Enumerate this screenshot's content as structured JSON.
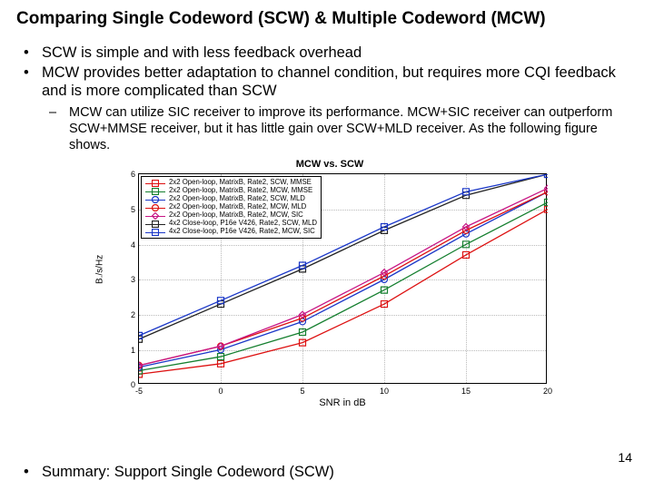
{
  "title": "Comparing Single Codeword (SCW) & Multiple Codeword (MCW)",
  "bullets": {
    "b1": "SCW is simple and with less feedback overhead",
    "b2": "MCW provides better adaptation to channel condition, but requires more CQI feedback and is more complicated than SCW",
    "b2sub": "MCW can utilize SIC receiver to improve its performance. MCW+SIC receiver can outperform SCW+MMSE receiver, but it has little gain over SCW+MLD receiver. As the following figure shows.",
    "summary": "Summary: Support Single Codeword (SCW)"
  },
  "page_number": "14",
  "chart_data": {
    "type": "line",
    "title": "MCW vs. SCW",
    "xlabel": "SNR in dB",
    "ylabel": "B./s/Hz",
    "xlim": [
      -5,
      20
    ],
    "ylim": [
      0,
      6
    ],
    "xticks": [
      -5,
      0,
      5,
      10,
      15,
      20
    ],
    "yticks": [
      0,
      1,
      2,
      3,
      4,
      5,
      6
    ],
    "x": [
      -5,
      0,
      5,
      10,
      15,
      20
    ],
    "series": [
      {
        "name": "2x2 Open-loop, MatrixB, Rate2, SCW, MMSE",
        "color": "#d11",
        "marker": "square",
        "values": [
          0.3,
          0.6,
          1.2,
          2.3,
          3.7,
          5.0
        ]
      },
      {
        "name": "2x2 Open-loop, MatrixB, Rate2, MCW, MMSE",
        "color": "#157f2f",
        "marker": "square",
        "values": [
          0.4,
          0.8,
          1.5,
          2.7,
          4.0,
          5.2
        ]
      },
      {
        "name": "2x2 Open-loop, MatrixB, Rate2, SCW, MLD",
        "color": "#1a37c8",
        "marker": "circle",
        "values": [
          0.5,
          1.0,
          1.8,
          3.0,
          4.3,
          5.5
        ]
      },
      {
        "name": "2x2 Open-loop, MatrixB, Rate2, MCW, MLD",
        "color": "#d11",
        "marker": "circle",
        "values": [
          0.55,
          1.1,
          1.9,
          3.1,
          4.4,
          5.5
        ]
      },
      {
        "name": "2x2 Open-loop, MatrixB, Rate2, MCW, SIC",
        "color": "#c71585",
        "marker": "diamond",
        "values": [
          0.55,
          1.1,
          2.0,
          3.2,
          4.5,
          5.6
        ]
      },
      {
        "name": "4x2 Close-loop, P16e V426, Rate2, SCW, MLD",
        "color": "#222",
        "marker": "square",
        "values": [
          1.3,
          2.3,
          3.3,
          4.4,
          5.4,
          6.0
        ]
      },
      {
        "name": "4x2 Close-loop, P16e V426, Rate2, MCW, SIC",
        "color": "#1a37c8",
        "marker": "square",
        "values": [
          1.4,
          2.4,
          3.4,
          4.5,
          5.5,
          6.0
        ]
      }
    ]
  }
}
